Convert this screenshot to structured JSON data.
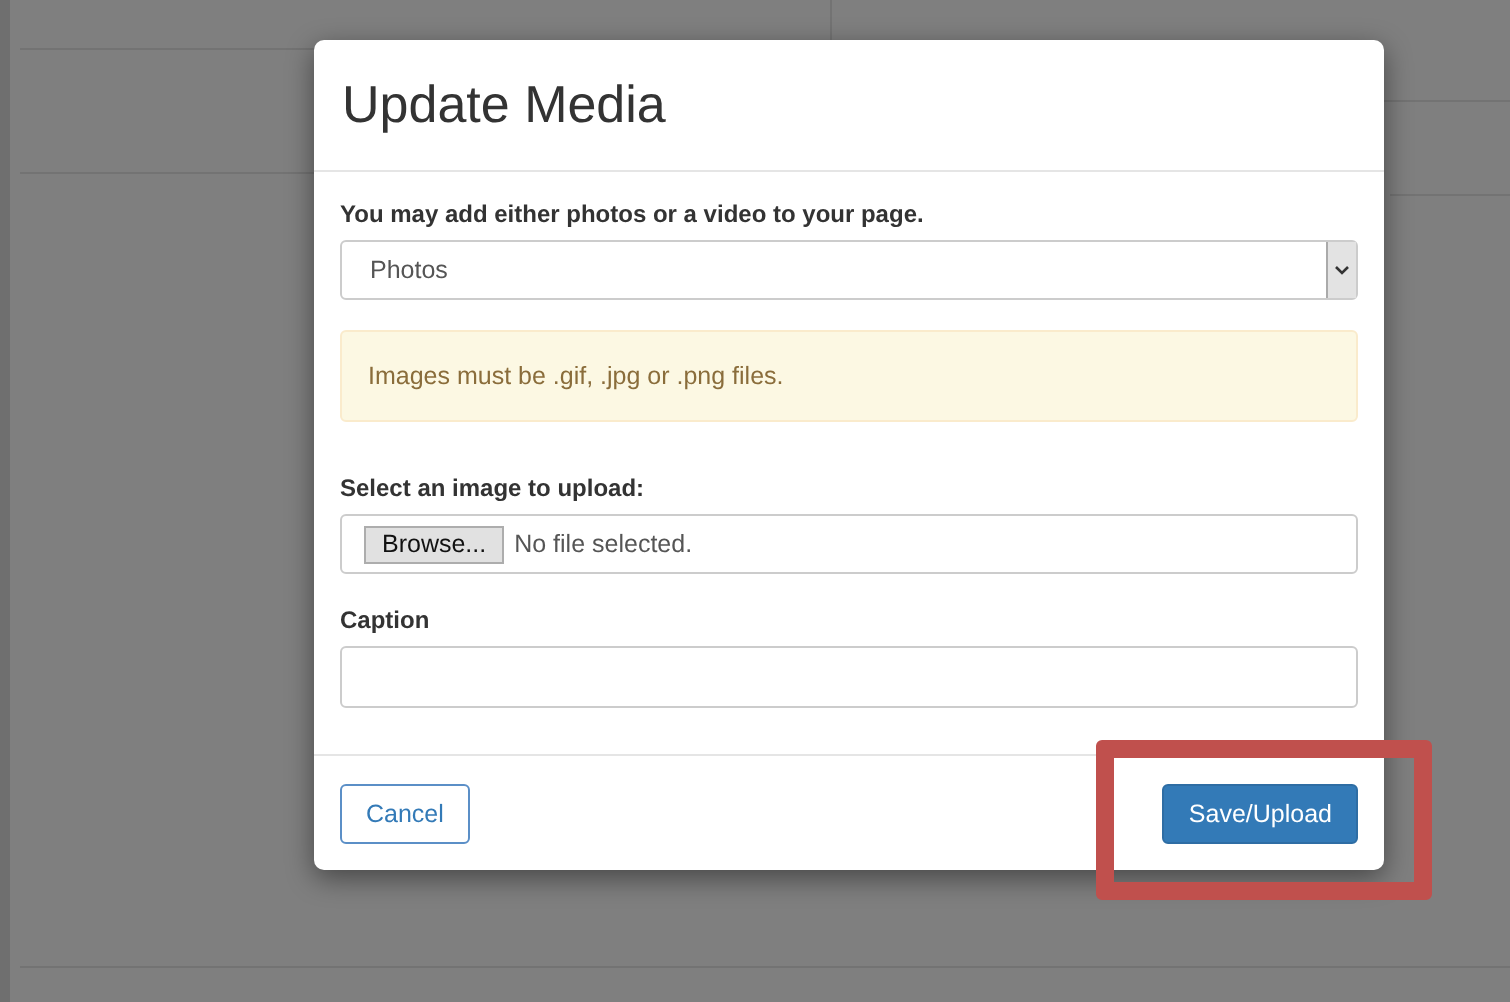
{
  "dialog": {
    "title": "Update Media",
    "media_field": {
      "label": "You may add either photos or a video to your page.",
      "value": "Photos"
    },
    "alert": "Images must be .gif, .jpg or .png files.",
    "file_field": {
      "label": "Select an image to upload:",
      "button": "Browse...",
      "status": "No file selected."
    },
    "caption_field": {
      "label": "Caption"
    },
    "buttons": [
      {
        "label": "Cancel",
        "kind": "default",
        "highlighted": false
      },
      {
        "label": "Save/Upload",
        "kind": "primary",
        "highlighted": true
      }
    ]
  }
}
